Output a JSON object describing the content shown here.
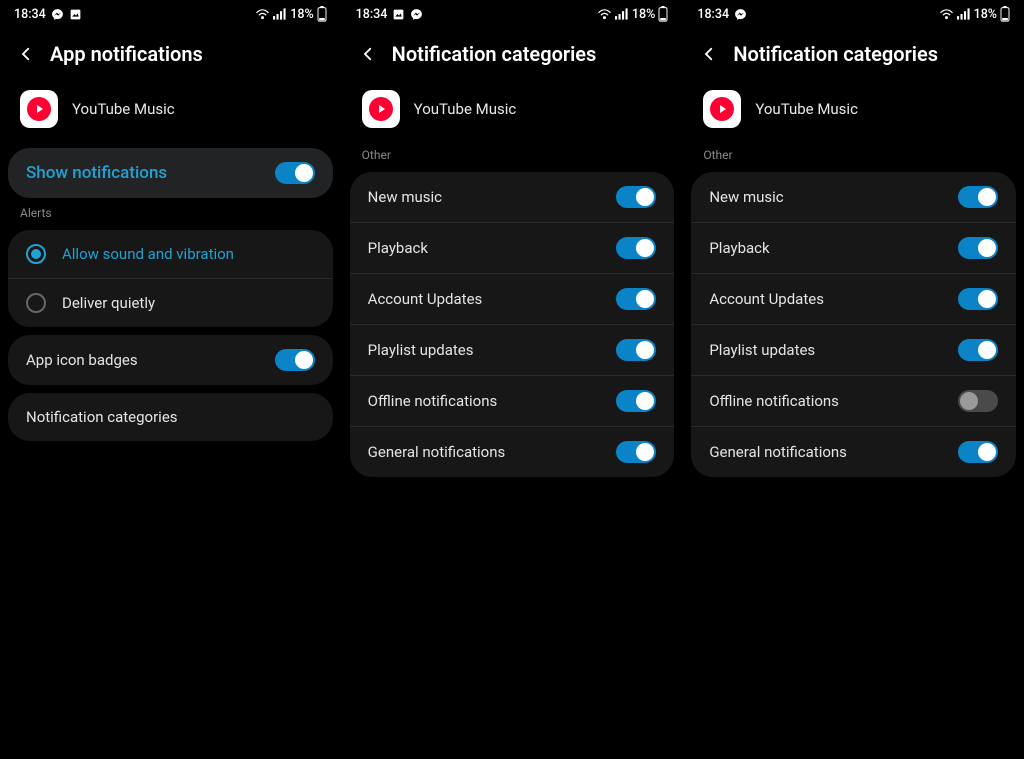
{
  "status": {
    "time": "18:34",
    "battery_pct": "18%"
  },
  "panes": [
    {
      "title": "App notifications",
      "app_name": "YouTube Music",
      "show_notifications_label": "Show notifications",
      "alerts_label": "Alerts",
      "radio": {
        "sound": "Allow sound and vibration",
        "quiet": "Deliver quietly"
      },
      "badges_label": "App icon badges",
      "categories_label": "Notification categories"
    },
    {
      "title": "Notification categories",
      "app_name": "YouTube Music",
      "section": "Other",
      "items": [
        {
          "label": "New music",
          "on": true
        },
        {
          "label": "Playback",
          "on": true
        },
        {
          "label": "Account Updates",
          "on": true
        },
        {
          "label": "Playlist updates",
          "on": true
        },
        {
          "label": "Offline notifications",
          "on": true
        },
        {
          "label": "General notifications",
          "on": true
        }
      ]
    },
    {
      "title": "Notification categories",
      "app_name": "YouTube Music",
      "section": "Other",
      "items": [
        {
          "label": "New music",
          "on": true
        },
        {
          "label": "Playback",
          "on": true
        },
        {
          "label": "Account Updates",
          "on": true
        },
        {
          "label": "Playlist updates",
          "on": true
        },
        {
          "label": "Offline notifications",
          "on": false
        },
        {
          "label": "General notifications",
          "on": true
        }
      ]
    }
  ]
}
